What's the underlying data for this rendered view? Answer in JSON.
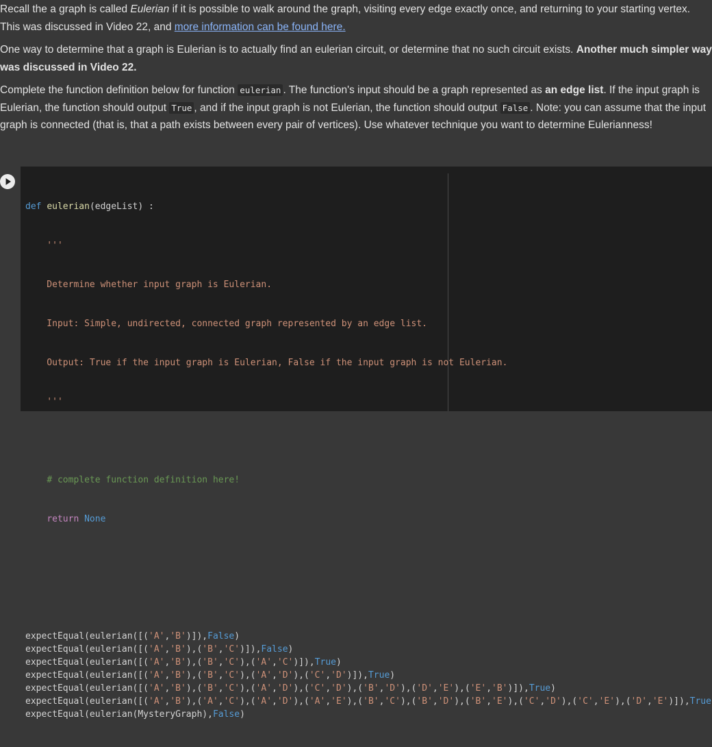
{
  "intro": {
    "p1_a": "Recall the a graph is called ",
    "p1_em": "Eulerian",
    "p1_b": " if it is possible to walk around the graph, visiting every edge exactly once, and returning to your starting vertex. This was discussed in Video 22, and ",
    "p1_link": "more information can be found here.",
    "p2_a": "One way to determine that a graph is Eulerian is to actually find an eulerian circuit, or determine that no such circuit exists. ",
    "p2_bold": "Another much simpler way was discussed in Video 22.",
    "p3_a": "Complete the function definition below for function ",
    "p3_code1": "eulerian",
    "p3_b": ". The function's input should be a graph represented as ",
    "p3_bold": "an edge list",
    "p3_c": ". If the input graph is Eulerian, the function should output ",
    "p3_code2": "True",
    "p3_d": ", and if the input graph is not Eulerian, the function should output ",
    "p3_code3": "False",
    "p3_e": ". Note: you can assume that the input graph is connected (that is, that a path exists between every pair of vertices). Use whatever technique you want to determine Eulerianness!"
  },
  "code": {
    "def_kw": "def",
    "func_name": "eulerian",
    "signature": "(edgeList) :",
    "doc_open": "    '''",
    "doc_line1": "    Determine whether input graph is Eulerian.",
    "doc_line2": "    Input: Simple, undirected, connected graph represented by an edge list.",
    "doc_line3": "    Output: True if the input graph is Eulerian, False if the input graph is not Eulerian.",
    "doc_close": "    '''",
    "comment": "# complete function definition here!",
    "return_kw": "return",
    "return_val": "None",
    "tests": [
      {
        "call": "expectEqual(eulerian([('A','B')]),",
        "expected": "False",
        "end": ")"
      },
      {
        "call": "expectEqual(eulerian([('A','B'),('B','C')]),",
        "expected": "False",
        "end": ")"
      },
      {
        "call": "expectEqual(eulerian([('A','B'),('B','C'),('A','C')]),",
        "expected": "True",
        "end": ")"
      },
      {
        "call": "expectEqual(eulerian([('A','B'),('B','C'),('A','D'),('C','D')]),",
        "expected": "True",
        "end": ")"
      },
      {
        "call": "expectEqual(eulerian([('A','B'),('B','C'),('A','D'),('C','D'),('B','D'),('D','E'),('E','B')]),",
        "expected": "True",
        "end": ")"
      },
      {
        "call": "expectEqual(eulerian([('A','B'),('A','C'),('A','D'),('A','E'),('B','C'),('B','D'),('B','E'),('C','D'),('C','E'),('D','E')]),",
        "expected": "True",
        "end": ")"
      },
      {
        "call": "expectEqual(eulerian(MysteryGraph),",
        "expected": "False",
        "end": ")"
      }
    ]
  },
  "icons": {
    "run": "play-icon"
  },
  "colors": {
    "link": "#8ab4f8",
    "keyword": "#569cd6",
    "string": "#ce9178",
    "comment": "#6a9955",
    "return": "#c586c0"
  }
}
